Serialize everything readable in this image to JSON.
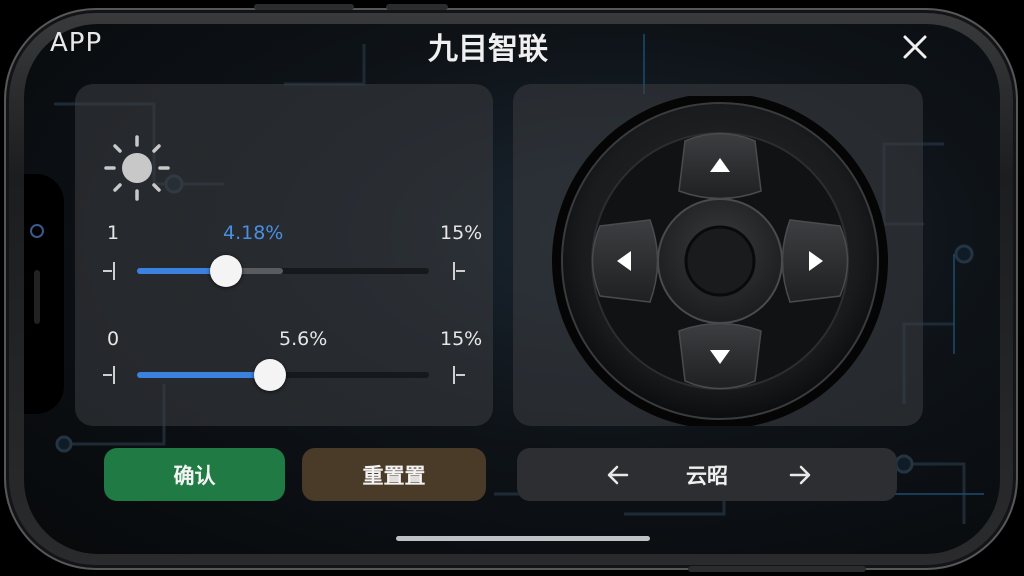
{
  "app_label": "APP",
  "title": "九目智联",
  "icons": {
    "close": "close-icon",
    "brightness": "sun-icon",
    "nav_prev": "arrow-left-icon",
    "nav_next": "arrow-right-icon"
  },
  "slider1": {
    "min_label": "1",
    "value_label": "4.18%",
    "max_label": "15%",
    "value_fraction": 0.305,
    "buffer_fraction": 0.5
  },
  "slider2": {
    "min_label": "0",
    "value_label": "5.6%",
    "max_label": "15%",
    "value_fraction": 0.455
  },
  "joystick": {
    "directions": [
      "up",
      "down",
      "left",
      "right"
    ]
  },
  "buttons": {
    "confirm": "确认",
    "reset": "重置置"
  },
  "nav": {
    "label": "云昭"
  },
  "colors": {
    "accent_blue": "#3b82e0",
    "value_blue": "#4a8fe0",
    "confirm_green": "#1f7a44",
    "reset_brown": "#4a3a28"
  }
}
